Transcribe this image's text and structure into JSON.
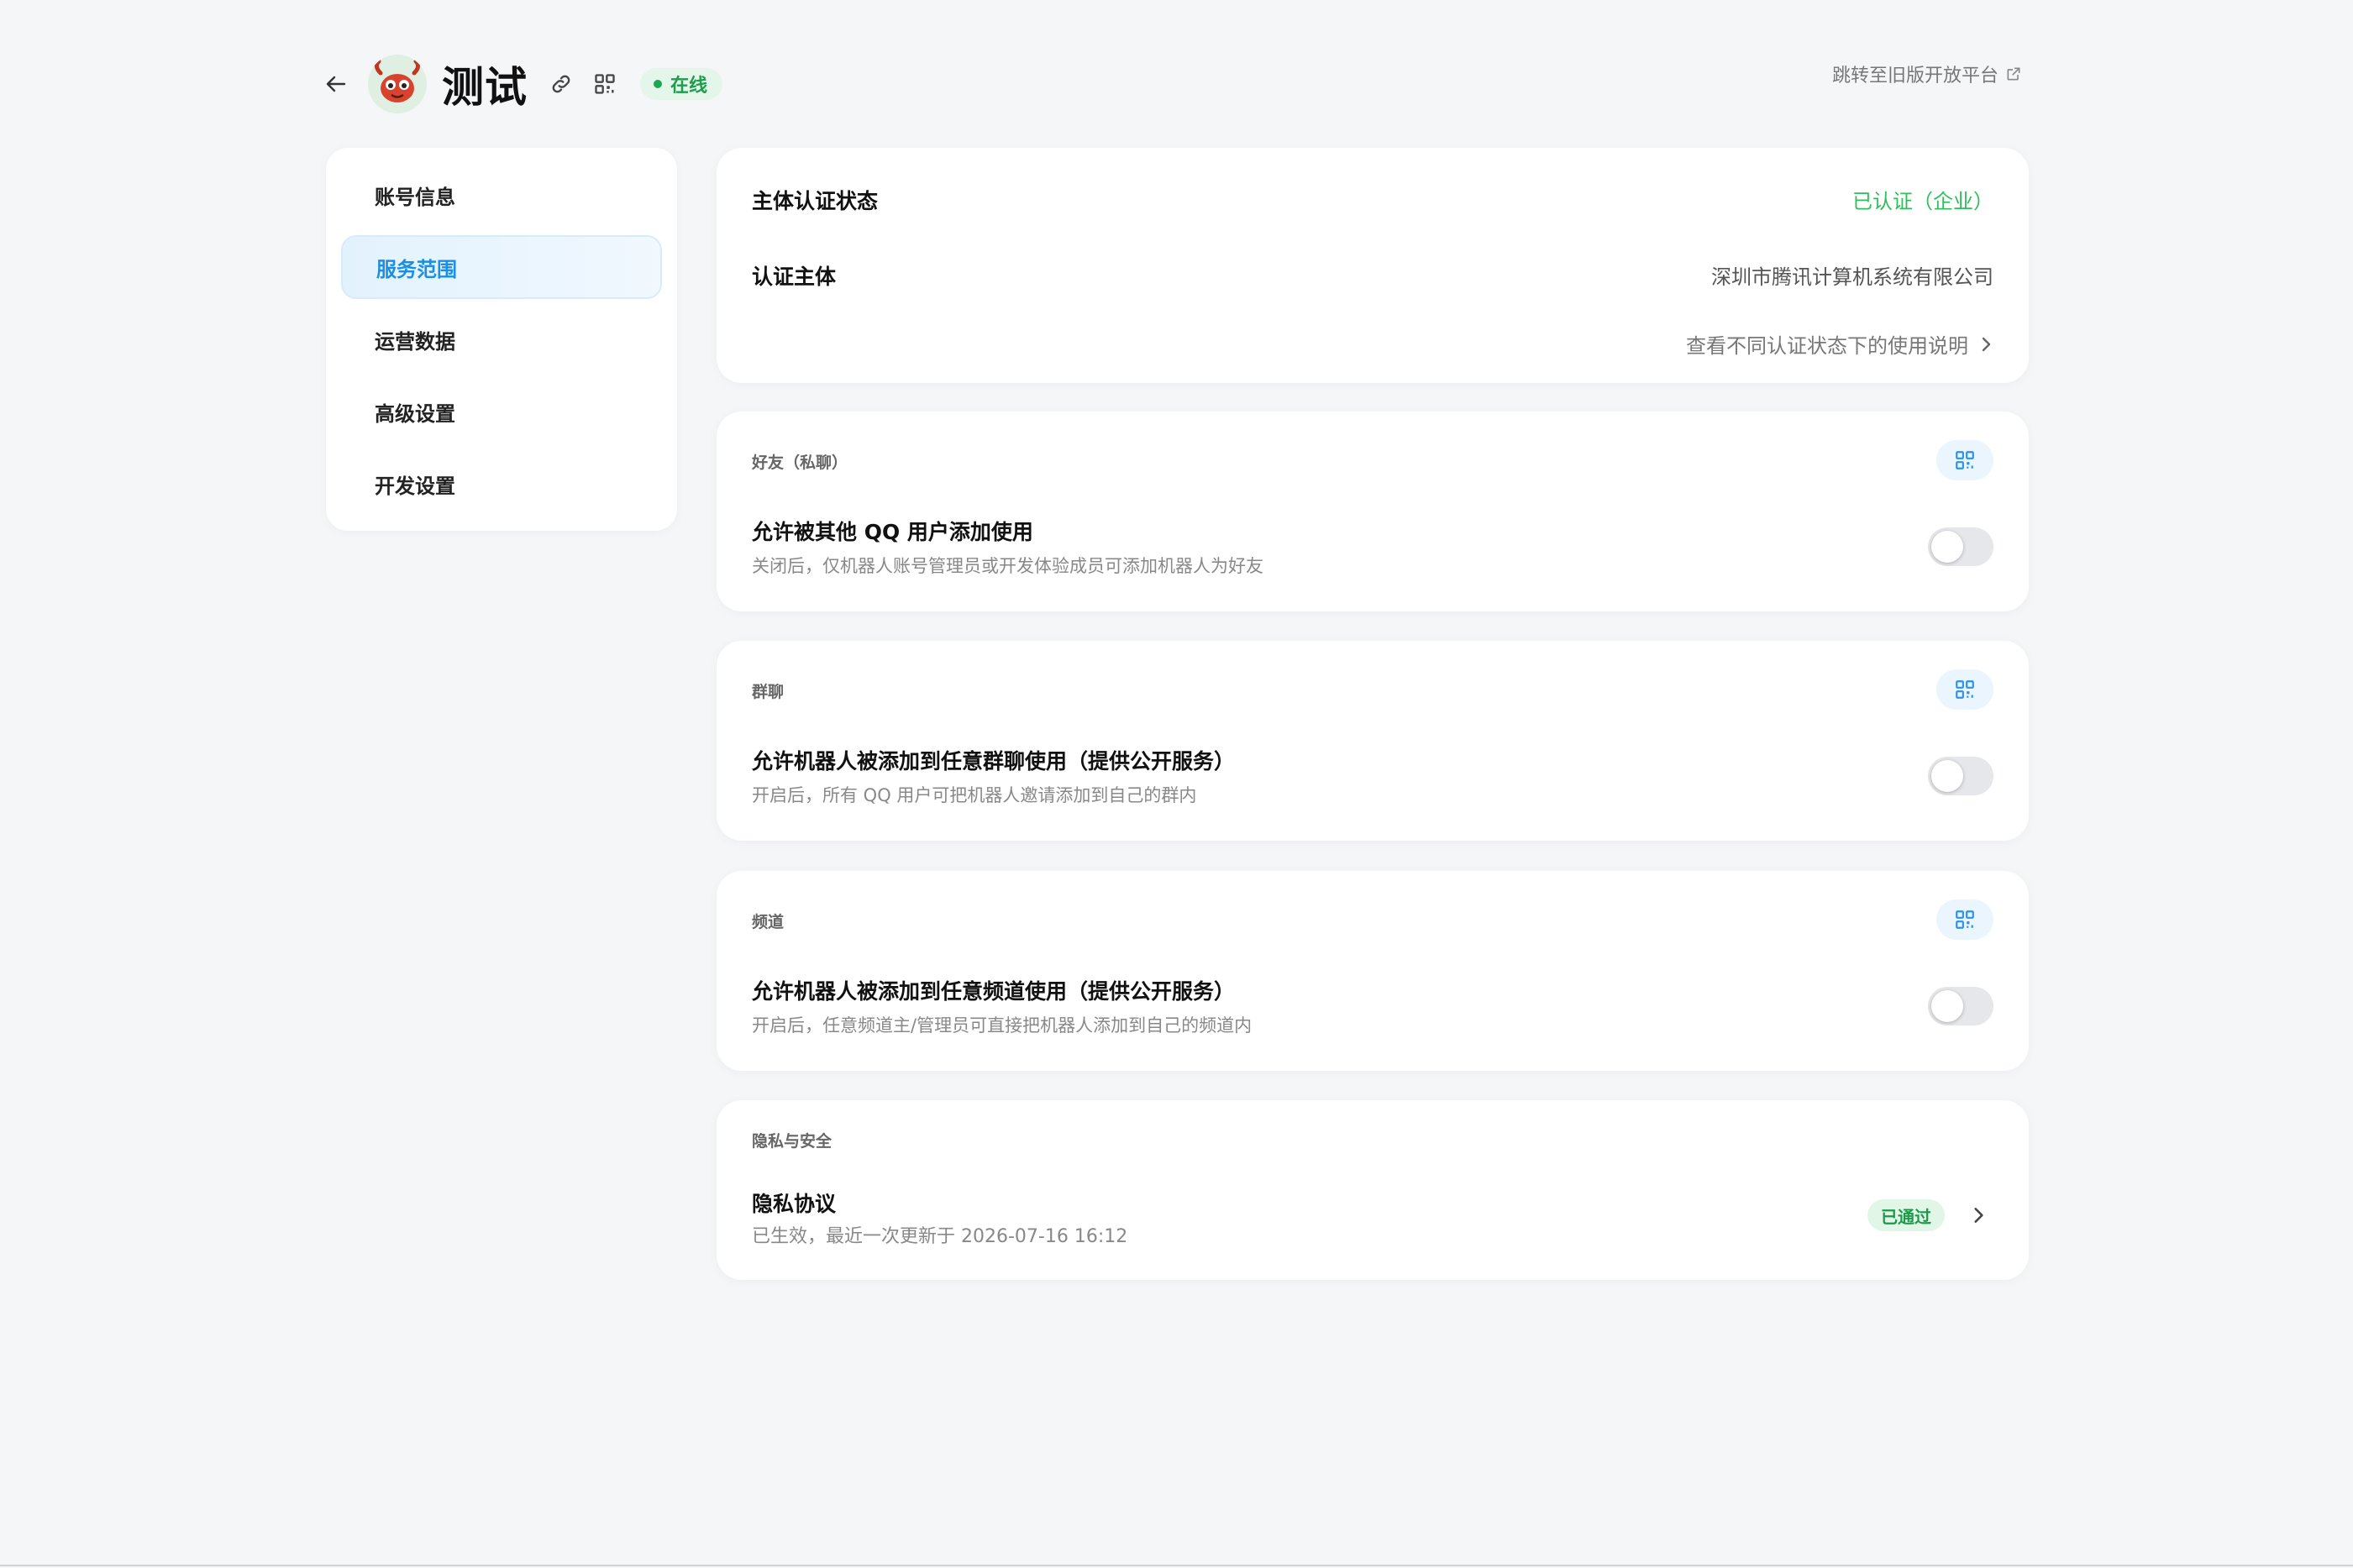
{
  "header": {
    "bot_name": "测试",
    "status": "在线",
    "legacy_link": "跳转至旧版开放平台"
  },
  "sidebar": {
    "items": [
      {
        "label": "账号信息",
        "active": false
      },
      {
        "label": "服务范围",
        "active": true
      },
      {
        "label": "运营数据",
        "active": false
      },
      {
        "label": "高级设置",
        "active": false
      },
      {
        "label": "开发设置",
        "active": false
      }
    ]
  },
  "auth": {
    "status_label": "主体认证状态",
    "status_value": "已认证（企业）",
    "subject_label": "认证主体",
    "subject_value": "深圳市腾讯计算机系统有限公司",
    "help_link": "查看不同认证状态下的使用说明"
  },
  "friend": {
    "section_title": "好友（私聊）",
    "option_title": "允许被其他 QQ 用户添加使用",
    "option_desc": "关闭后，仅机器人账号管理员或开发体验成员可添加机器人为好友",
    "enabled": false
  },
  "group": {
    "section_title": "群聊",
    "option_title": "允许机器人被添加到任意群聊使用（提供公开服务）",
    "option_desc": "开启后，所有 QQ 用户可把机器人邀请添加到自己的群内",
    "enabled": false
  },
  "channel": {
    "section_title": "频道",
    "option_title": "允许机器人被添加到任意频道使用（提供公开服务）",
    "option_desc": "开启后，任意频道主/管理员可直接把机器人添加到自己的频道内",
    "enabled": false
  },
  "privacy": {
    "section_title": "隐私与安全",
    "title": "隐私协议",
    "desc": "已生效，最近一次更新于 2026-07-16 16:12",
    "badge": "已通过"
  },
  "colors": {
    "accent": "#1a8fe3",
    "success": "#2fbf5a",
    "background": "#f5f6f8"
  },
  "icons": [
    "back-arrow-icon",
    "avatar-crab-icon",
    "link-icon",
    "qrcode-icon",
    "external-link-icon",
    "chevron-right-icon"
  ]
}
